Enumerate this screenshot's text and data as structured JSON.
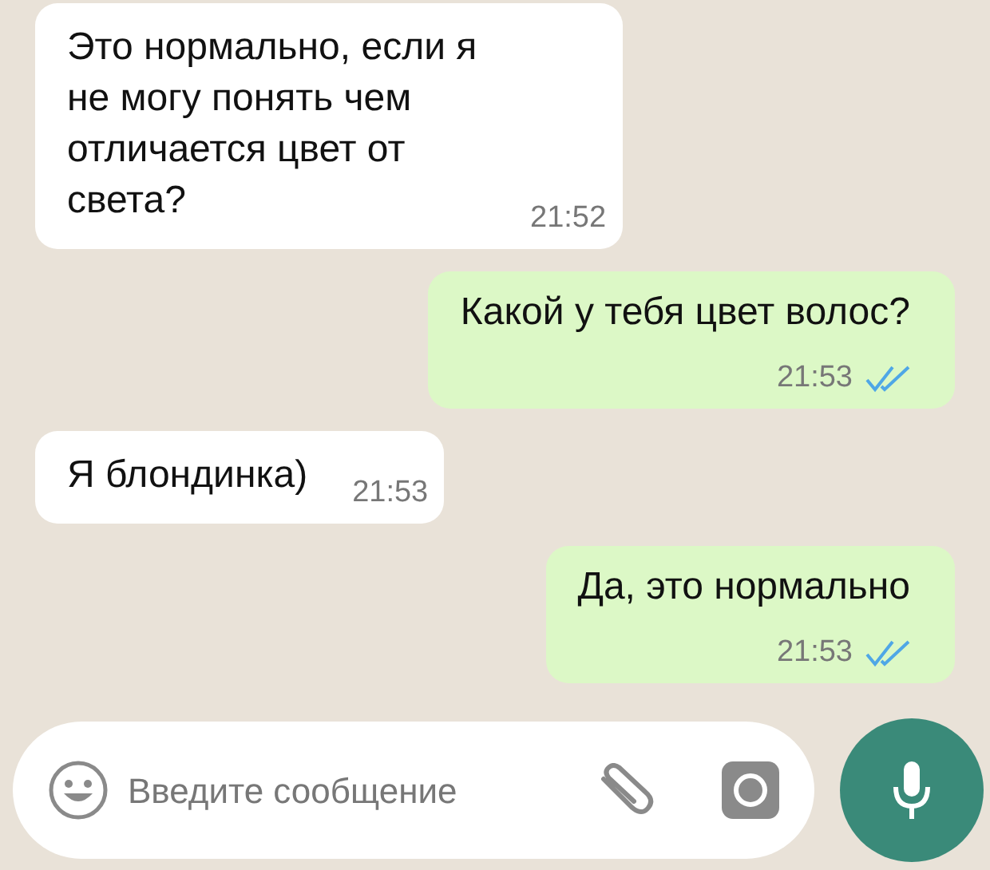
{
  "messages": [
    {
      "kind": "in",
      "text": "Это нормально, если я не могу понять чем отличается цвет от света?",
      "time": "21:52"
    },
    {
      "kind": "out",
      "text": "Какой у тебя цвет волос?",
      "time": "21:53",
      "read": true
    },
    {
      "kind": "in",
      "text": "Я блондинка)",
      "time": "21:53"
    },
    {
      "kind": "out",
      "text": "Да, это нормально",
      "time": "21:53",
      "read": true
    }
  ],
  "composer": {
    "placeholder": "Введите сообщение"
  }
}
